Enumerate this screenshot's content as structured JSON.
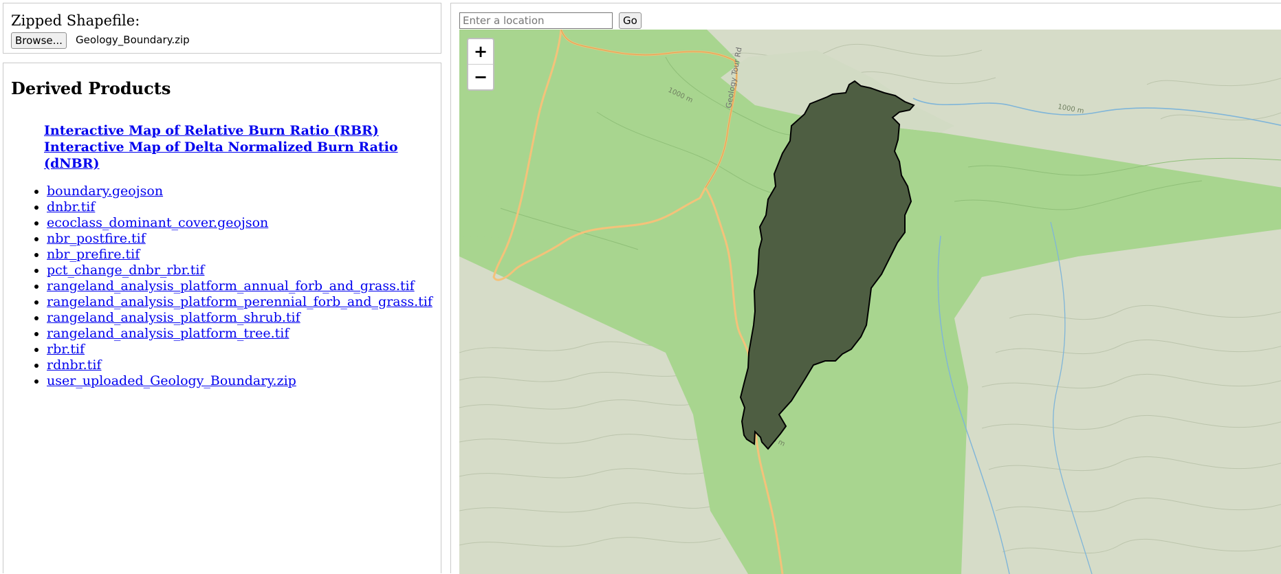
{
  "upload": {
    "label": "Zipped Shapefile:",
    "browse_label": "Browse...",
    "file_name": "Geology_Boundary.zip"
  },
  "products": {
    "heading": "Derived Products",
    "map_links": [
      "Interactive Map of Relative Burn Ratio (RBR)",
      "Interactive Map of Delta Normalized Burn Ratio (dNBR)"
    ],
    "files": [
      "boundary.geojson",
      "dnbr.tif",
      "ecoclass_dominant_cover.geojson",
      "nbr_postfire.tif",
      "nbr_prefire.tif",
      "pct_change_dnbr_rbr.tif",
      "rangeland_analysis_platform_annual_forb_and_grass.tif",
      "rangeland_analysis_platform_perennial_forb_and_grass.tif",
      "rangeland_analysis_platform_shrub.tif",
      "rangeland_analysis_platform_tree.tif",
      "rbr.tif",
      "rdnbr.tif",
      "user_uploaded_Geology_Boundary.zip"
    ]
  },
  "map": {
    "search_placeholder": "Enter a location",
    "go_label": "Go",
    "zoom_in": "+",
    "zoom_out": "−",
    "labels": {
      "road": "Geology Tour Rd",
      "contour_1": "1000 m",
      "contour_2": "1000 m",
      "contour_3": "1100 m"
    },
    "colors": {
      "terrain": "#d6dcc8",
      "park_green": "#a8d58f",
      "boundary_fill": "#4e5e42",
      "boundary_stroke": "#000000",
      "road": "#f4c27a",
      "stream": "#7fb5d9"
    }
  }
}
